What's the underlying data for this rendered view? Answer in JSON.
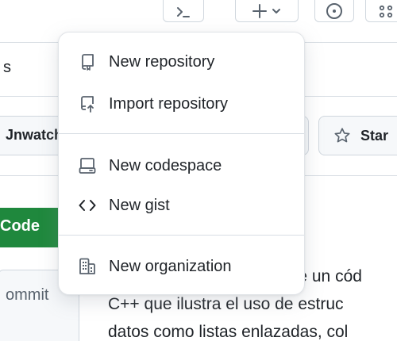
{
  "header": {
    "icons": [
      "terminal-icon",
      "plus-icon",
      "issue-icon",
      "copilot-icon"
    ]
  },
  "tabs": {
    "partial_label": "s"
  },
  "actions": {
    "unwatch_label": "Jnwatch",
    "star_label": "Star"
  },
  "code_button": {
    "label": "Code"
  },
  "side_panel": {
    "commits_label": "ommit"
  },
  "description": {
    "line1": "ene un cód",
    "line2": "C++ que ilustra el uso de estruc",
    "line3": "datos como listas enlazadas, col"
  },
  "menu": {
    "items": [
      {
        "label": "New repository",
        "icon": "repo-icon"
      },
      {
        "label": "Import repository",
        "icon": "repo-push-icon"
      },
      {
        "label": "New codespace",
        "icon": "codespaces-icon"
      },
      {
        "label": "New gist",
        "icon": "code-icon"
      },
      {
        "label": "New organization",
        "icon": "organization-icon"
      }
    ]
  },
  "colors": {
    "primary_button": "#1f883d",
    "border": "#d0d7de",
    "muted_text": "#59636e"
  }
}
